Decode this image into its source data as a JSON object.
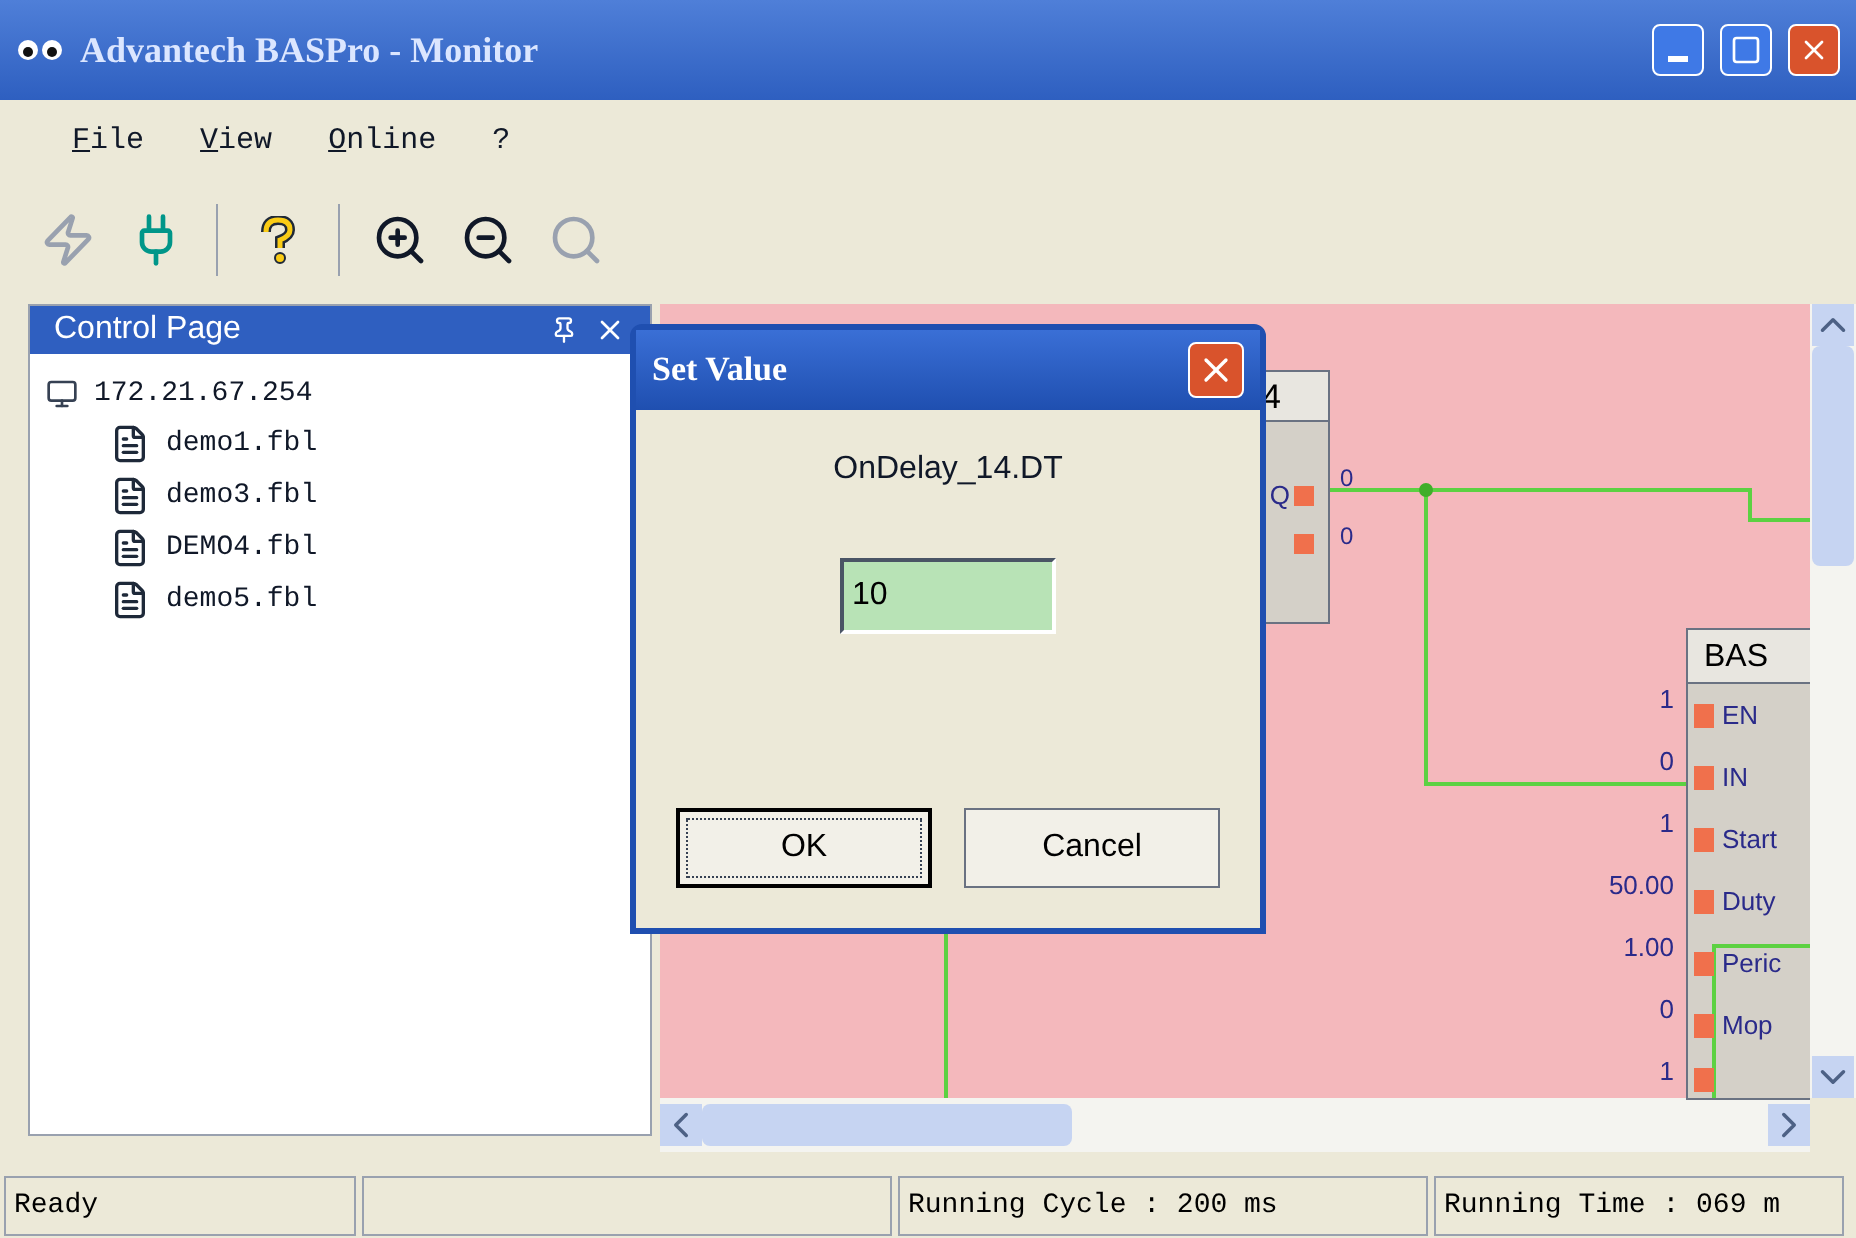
{
  "window": {
    "title": "Advantech BASPro - Monitor"
  },
  "menu": [
    {
      "label": "File"
    },
    {
      "label": "View"
    },
    {
      "label": "Online"
    },
    {
      "label": "?"
    }
  ],
  "toolbar": [
    {
      "kind": "lightning",
      "disabled": true
    },
    {
      "kind": "plug",
      "disabled": false
    },
    {
      "kind": "sep"
    },
    {
      "kind": "help",
      "disabled": false
    },
    {
      "kind": "sep"
    },
    {
      "kind": "zoom-in",
      "disabled": false
    },
    {
      "kind": "zoom-out",
      "disabled": false
    },
    {
      "kind": "zoom-reset",
      "disabled": true
    }
  ],
  "control_page": {
    "title": "Control Page",
    "tree": [
      {
        "label": "172.21.67.254",
        "children": [
          {
            "label": "demo1.fbl"
          },
          {
            "label": "demo3.fbl"
          },
          {
            "label": "DEMO4.fbl"
          },
          {
            "label": "demo5.fbl"
          }
        ]
      }
    ]
  },
  "diagram": {
    "blocks": [
      {
        "title": "4",
        "pins": [
          {
            "label": "Q",
            "value": "0"
          },
          {
            "value": "0"
          }
        ]
      },
      {
        "title": "BAS",
        "pins": [
          {
            "label": "EN",
            "value": "1"
          },
          {
            "label": "IN",
            "value": "0"
          },
          {
            "label": "Start",
            "value": "1"
          },
          {
            "label": "Duty",
            "value": "50.00"
          },
          {
            "label": "Peric",
            "value": "1.00"
          },
          {
            "label": "Mop",
            "value": "0"
          },
          {
            "value": "1"
          }
        ]
      }
    ]
  },
  "dialog": {
    "title": "Set Value",
    "label": "OnDelay_14.DT",
    "value": "10",
    "buttons": [
      {
        "label": "OK",
        "default": true
      },
      {
        "label": "Cancel",
        "default": false
      }
    ]
  },
  "status_bar": [
    {
      "text": "Ready"
    },
    {
      "text": "Running Cycle : 200 ms"
    },
    {
      "text": "Running Time : 069 m"
    }
  ]
}
